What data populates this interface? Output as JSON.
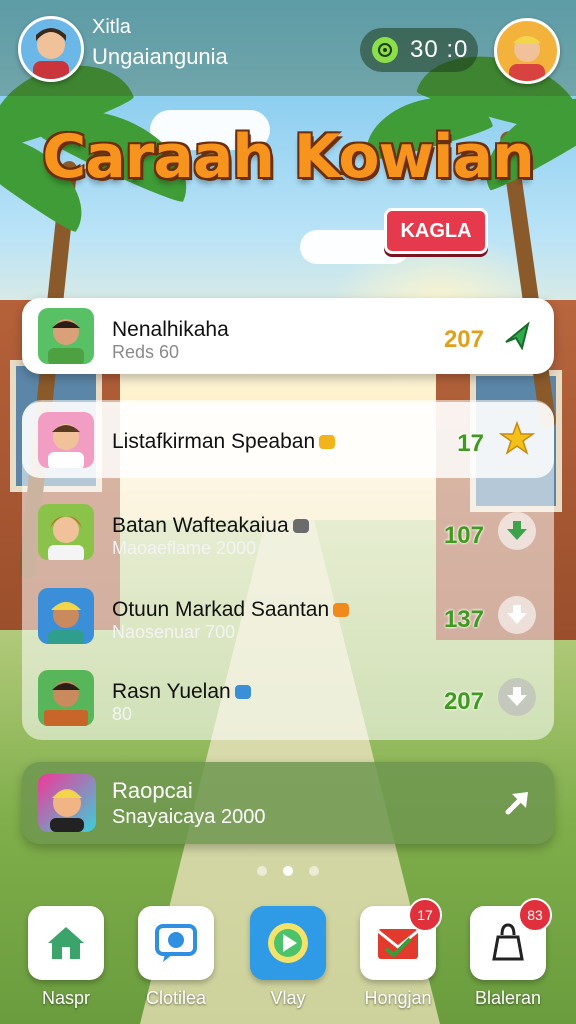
{
  "header": {
    "user_name": "Xitla",
    "user_subtitle": "Ungaiangunia",
    "timer": "30 :0"
  },
  "game": {
    "title": "Caraah Kowian",
    "badge": "KAGLA"
  },
  "leaderboard": {
    "top": {
      "name": "Nenalhikaha",
      "sub": "Reds 60",
      "score": "207"
    },
    "rows": [
      {
        "name": "Listafkirman Speaban",
        "sub": "",
        "score": "17"
      },
      {
        "name": "Batan Wafteakaiua",
        "sub": "Maoaeflame 2000",
        "score": "107"
      },
      {
        "name": "Otuun Markad Saantan",
        "sub": "Naosenuar 700",
        "score": "137"
      },
      {
        "name": "Rasn Yuelan",
        "sub": "80",
        "score": "207"
      }
    ]
  },
  "featured": {
    "name": "Raopcai",
    "sub": "Snayaicaya 2000"
  },
  "nav": [
    {
      "label": "Naspr",
      "icon": "home-icon"
    },
    {
      "label": "Clotilea",
      "icon": "chat-icon"
    },
    {
      "label": "Vlay",
      "icon": "play-icon"
    },
    {
      "label": "Hongjan",
      "icon": "mail-icon",
      "badge": "17"
    },
    {
      "label": "Blaleran",
      "icon": "bag-icon",
      "badge": "83"
    }
  ],
  "colors": {
    "accent_green": "#3e9b1d",
    "title_orange": "#f7941d",
    "badge_red": "#e63a4c"
  }
}
